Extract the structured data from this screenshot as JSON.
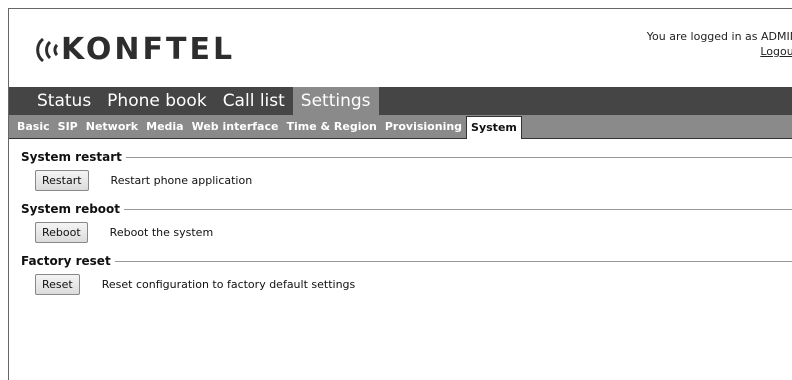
{
  "header": {
    "logo_text": "KONFTEL",
    "logged_in_text": "You are logged in as ADMIN",
    "logout_label": "Logout"
  },
  "main_nav": [
    {
      "label": "Status",
      "active": false
    },
    {
      "label": "Phone book",
      "active": false
    },
    {
      "label": "Call list",
      "active": false
    },
    {
      "label": "Settings",
      "active": true
    }
  ],
  "sub_nav": [
    {
      "label": "Basic",
      "active": false
    },
    {
      "label": "SIP",
      "active": false
    },
    {
      "label": "Network",
      "active": false
    },
    {
      "label": "Media",
      "active": false
    },
    {
      "label": "Web interface",
      "active": false
    },
    {
      "label": "Time & Region",
      "active": false
    },
    {
      "label": "Provisioning",
      "active": false
    },
    {
      "label": "System",
      "active": true
    }
  ],
  "sections": [
    {
      "title": "System restart",
      "button": "Restart",
      "description": "Restart phone application"
    },
    {
      "title": "System reboot",
      "button": "Reboot",
      "description": "Reboot the system"
    },
    {
      "title": "Factory reset",
      "button": "Reset",
      "description": "Reset configuration to factory default settings"
    }
  ],
  "colors": {
    "main_nav_bg": "#454545",
    "active_tab_bg": "#8a8a8a",
    "sub_nav_bg": "#8a8a8a"
  }
}
